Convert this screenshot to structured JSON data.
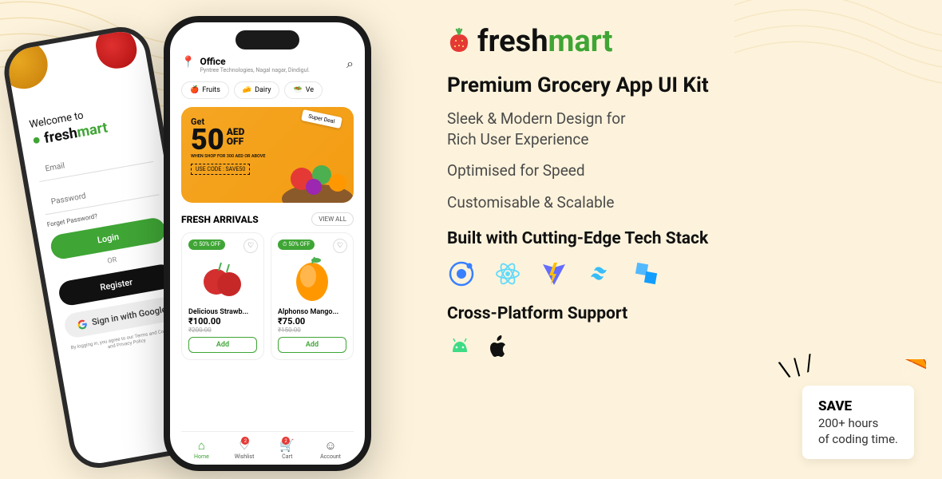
{
  "brand": {
    "part1": "fresh",
    "part2": "mart"
  },
  "login": {
    "welcome": "Welcome to",
    "email_ph": "Email",
    "pwd_ph": "Password",
    "forget": "Forget Password?",
    "login": "Login",
    "or": "OR",
    "register": "Register",
    "google": "Sign in with Google",
    "terms": "By logging in, you agree to our Terms and Conditions and Privacy Policy"
  },
  "home": {
    "addr_label": "Office",
    "addr_sub": "Pyntree Technologies, Nagal nagar, Dindigul.",
    "chips": [
      "Fruits",
      "Dairy",
      "Ve"
    ],
    "banner": {
      "get": "Get",
      "amount": "50",
      "unit_top": "AED",
      "unit_bot": "OFF",
      "sub": "WHEN SHOP FOR 300 AED OR ABOVE",
      "code": "USE CODE : SAVE50",
      "tag": "Super Deal"
    },
    "section": "FRESH ARRIVALS",
    "viewall": "VIEW ALL",
    "products": [
      {
        "badge": "⏱ 50% OFF",
        "name": "Delicious Strawb...",
        "price": "₹100.00",
        "old": "₹200.00",
        "add": "Add"
      },
      {
        "badge": "⏱ 50% OFF",
        "name": "Alphonso Mango...",
        "price": "₹75.00",
        "old": "₹150.00",
        "add": "Add"
      }
    ],
    "tabs": [
      {
        "icon": "⌂",
        "label": "Home",
        "active": true
      },
      {
        "icon": "♡",
        "label": "Wishlist",
        "badge": "2"
      },
      {
        "icon": "🛒",
        "label": "Cart",
        "badge": "2"
      },
      {
        "icon": "☺",
        "label": "Account"
      }
    ]
  },
  "promo": {
    "title": "Premium Grocery App UI Kit",
    "f1a": "Sleek & Modern Design for",
    "f1b": "Rich User Experience",
    "f2": "Optimised for Speed",
    "f3": "Customisable & Scalable",
    "tech_title": "Built with Cutting-Edge Tech Stack",
    "cross_title": "Cross-Platform Support",
    "save_t": "SAVE",
    "save_l1": "200+ hours",
    "save_l2": "of coding time."
  }
}
